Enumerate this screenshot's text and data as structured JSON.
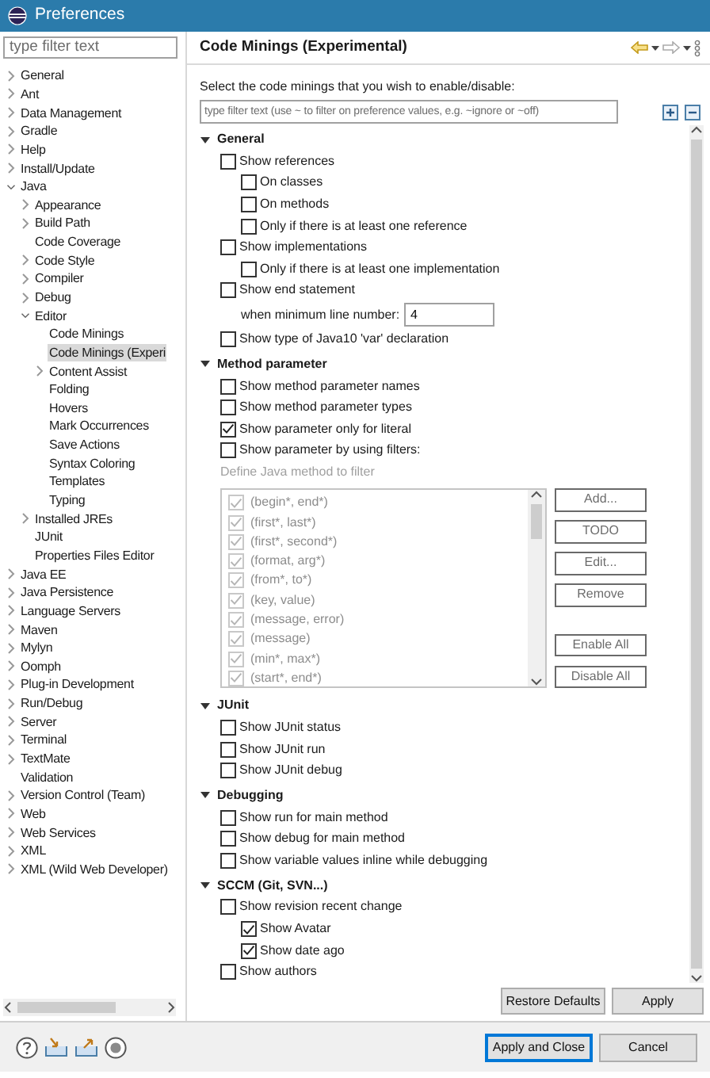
{
  "window": {
    "title": "Preferences"
  },
  "sidebar": {
    "filter": {
      "placeholder": "type filter text"
    },
    "items": [
      {
        "label": "General",
        "expandable": true,
        "expanded": false,
        "selected": false
      },
      {
        "label": "Ant",
        "expandable": true,
        "expanded": false,
        "selected": false
      },
      {
        "label": "Data Management",
        "expandable": true,
        "expanded": false,
        "selected": false
      },
      {
        "label": "Gradle",
        "expandable": true,
        "expanded": false,
        "selected": false
      },
      {
        "label": "Help",
        "expandable": true,
        "expanded": false,
        "selected": false
      },
      {
        "label": "Install/Update",
        "expandable": true,
        "expanded": false,
        "selected": false
      },
      {
        "label": "Java",
        "expandable": true,
        "expanded": true,
        "selected": false,
        "children": [
          {
            "label": "Appearance",
            "expandable": true,
            "expanded": false,
            "selected": false
          },
          {
            "label": "Build Path",
            "expandable": true,
            "expanded": false,
            "selected": false
          },
          {
            "label": "Code Coverage",
            "expandable": false,
            "selected": false
          },
          {
            "label": "Code Style",
            "expandable": true,
            "expanded": false,
            "selected": false
          },
          {
            "label": "Compiler",
            "expandable": true,
            "expanded": false,
            "selected": false
          },
          {
            "label": "Debug",
            "expandable": true,
            "expanded": false,
            "selected": false
          },
          {
            "label": "Editor",
            "expandable": true,
            "expanded": true,
            "selected": false,
            "children": [
              {
                "label": "Code Minings",
                "expandable": false,
                "selected": false
              },
              {
                "label": "Code Minings (Experi",
                "expandable": false,
                "selected": true
              },
              {
                "label": "Content Assist",
                "expandable": true,
                "expanded": false,
                "selected": false
              },
              {
                "label": "Folding",
                "expandable": false,
                "selected": false
              },
              {
                "label": "Hovers",
                "expandable": false,
                "selected": false
              },
              {
                "label": "Mark Occurrences",
                "expandable": false,
                "selected": false
              },
              {
                "label": "Save Actions",
                "expandable": false,
                "selected": false
              },
              {
                "label": "Syntax Coloring",
                "expandable": false,
                "selected": false
              },
              {
                "label": "Templates",
                "expandable": false,
                "selected": false
              },
              {
                "label": "Typing",
                "expandable": false,
                "selected": false
              }
            ]
          },
          {
            "label": "Installed JREs",
            "expandable": true,
            "expanded": false,
            "selected": false
          },
          {
            "label": "JUnit",
            "expandable": false,
            "selected": false
          },
          {
            "label": "Properties Files Editor",
            "expandable": false,
            "selected": false
          }
        ]
      },
      {
        "label": "Java EE",
        "expandable": true,
        "expanded": false,
        "selected": false
      },
      {
        "label": "Java Persistence",
        "expandable": true,
        "expanded": false,
        "selected": false
      },
      {
        "label": "Language Servers",
        "expandable": true,
        "expanded": false,
        "selected": false
      },
      {
        "label": "Maven",
        "expandable": true,
        "expanded": false,
        "selected": false
      },
      {
        "label": "Mylyn",
        "expandable": true,
        "expanded": false,
        "selected": false
      },
      {
        "label": "Oomph",
        "expandable": true,
        "expanded": false,
        "selected": false
      },
      {
        "label": "Plug-in Development",
        "expandable": true,
        "expanded": false,
        "selected": false
      },
      {
        "label": "Run/Debug",
        "expandable": true,
        "expanded": false,
        "selected": false
      },
      {
        "label": "Server",
        "expandable": true,
        "expanded": false,
        "selected": false
      },
      {
        "label": "Terminal",
        "expandable": true,
        "expanded": false,
        "selected": false
      },
      {
        "label": "TextMate",
        "expandable": true,
        "expanded": false,
        "selected": false
      },
      {
        "label": "Validation",
        "expandable": false,
        "selected": false
      },
      {
        "label": "Version Control (Team)",
        "expandable": true,
        "expanded": false,
        "selected": false
      },
      {
        "label": "Web",
        "expandable": true,
        "expanded": false,
        "selected": false
      },
      {
        "label": "Web Services",
        "expandable": true,
        "expanded": false,
        "selected": false
      },
      {
        "label": "XML",
        "expandable": true,
        "expanded": false,
        "selected": false
      },
      {
        "label": "XML (Wild Web Developer)",
        "expandable": true,
        "expanded": false,
        "selected": false
      }
    ]
  },
  "page": {
    "title": "Code Minings (Experimental)",
    "description": "Select the code minings that you wish to enable/disable:",
    "filter": {
      "placeholder": "type filter text (use ~ to filter on preference values, e.g. ~ignore or ~off)"
    },
    "sections": [
      {
        "title": "General",
        "expanded": true,
        "options": [
          {
            "kind": "checkbox",
            "label": "Show references",
            "checked": false,
            "children": [
              {
                "kind": "checkbox",
                "label": "On classes",
                "checked": false
              },
              {
                "kind": "checkbox",
                "label": "On methods",
                "checked": false
              },
              {
                "kind": "checkbox",
                "label": "Only if there is at least one reference",
                "checked": false
              }
            ]
          },
          {
            "kind": "checkbox",
            "label": "Show implementations",
            "checked": false,
            "children": [
              {
                "kind": "checkbox",
                "label": "Only if there is at least one implementation",
                "checked": false
              }
            ]
          },
          {
            "kind": "checkbox",
            "label": "Show end statement",
            "checked": false,
            "children": [
              {
                "kind": "number",
                "label": "when minimum line number:",
                "value": "4"
              }
            ]
          },
          {
            "kind": "checkbox",
            "label": "Show type of Java10 'var' declaration",
            "checked": false
          }
        ]
      },
      {
        "title": "Method parameter",
        "expanded": true,
        "options": [
          {
            "kind": "checkbox",
            "label": "Show method parameter names",
            "checked": false
          },
          {
            "kind": "checkbox",
            "label": "Show method parameter types",
            "checked": false
          },
          {
            "kind": "checkbox",
            "label": "Show parameter only for literal",
            "checked": true
          },
          {
            "kind": "checkbox",
            "label": "Show parameter by using filters:",
            "checked": false
          },
          {
            "kind": "filter-list",
            "label": "Define Java method to filter",
            "disabled": true,
            "items": [
              {
                "label": "(begin*, end*)",
                "checked": true
              },
              {
                "label": "(first*, last*)",
                "checked": true
              },
              {
                "label": "(first*, second*)",
                "checked": true
              },
              {
                "label": "(format, arg*)",
                "checked": true
              },
              {
                "label": "(from*, to*)",
                "checked": true
              },
              {
                "label": "(key, value)",
                "checked": true
              },
              {
                "label": "(message, error)",
                "checked": true
              },
              {
                "label": "(message)",
                "checked": true
              },
              {
                "label": "(min*, max*)",
                "checked": true
              },
              {
                "label": "(start*, end*)",
                "checked": true
              }
            ],
            "buttons": [
              {
                "label": "Add...",
                "disabled": true
              },
              {
                "label": "TODO",
                "disabled": true
              },
              {
                "label": "Edit...",
                "disabled": true
              },
              {
                "label": "Remove",
                "disabled": true
              },
              {
                "label": "Enable All",
                "disabled": true
              },
              {
                "label": "Disable All",
                "disabled": true
              }
            ]
          }
        ]
      },
      {
        "title": "JUnit",
        "expanded": true,
        "options": [
          {
            "kind": "checkbox",
            "label": "Show JUnit status",
            "checked": false
          },
          {
            "kind": "checkbox",
            "label": "Show JUnit run",
            "checked": false
          },
          {
            "kind": "checkbox",
            "label": "Show JUnit debug",
            "checked": false
          }
        ]
      },
      {
        "title": "Debugging",
        "expanded": true,
        "options": [
          {
            "kind": "checkbox",
            "label": "Show run for main method",
            "checked": false
          },
          {
            "kind": "checkbox",
            "label": "Show debug for main method",
            "checked": false
          },
          {
            "kind": "checkbox",
            "label": "Show variable values inline while debugging",
            "checked": false
          }
        ]
      },
      {
        "title": "SCCM (Git, SVN...)",
        "expanded": true,
        "options": [
          {
            "kind": "checkbox",
            "label": "Show revision recent change",
            "checked": false,
            "children": [
              {
                "kind": "checkbox",
                "label": "Show Avatar",
                "checked": true
              },
              {
                "kind": "checkbox",
                "label": "Show date ago",
                "checked": true
              }
            ]
          },
          {
            "kind": "checkbox",
            "label": "Show authors",
            "checked": false
          }
        ]
      }
    ],
    "buttons": [
      {
        "label": "Restore Defaults"
      },
      {
        "label": "Apply"
      }
    ]
  },
  "footer": {
    "buttons": [
      {
        "label": "Apply and Close",
        "default": true
      },
      {
        "label": "Cancel",
        "default": false
      }
    ]
  }
}
